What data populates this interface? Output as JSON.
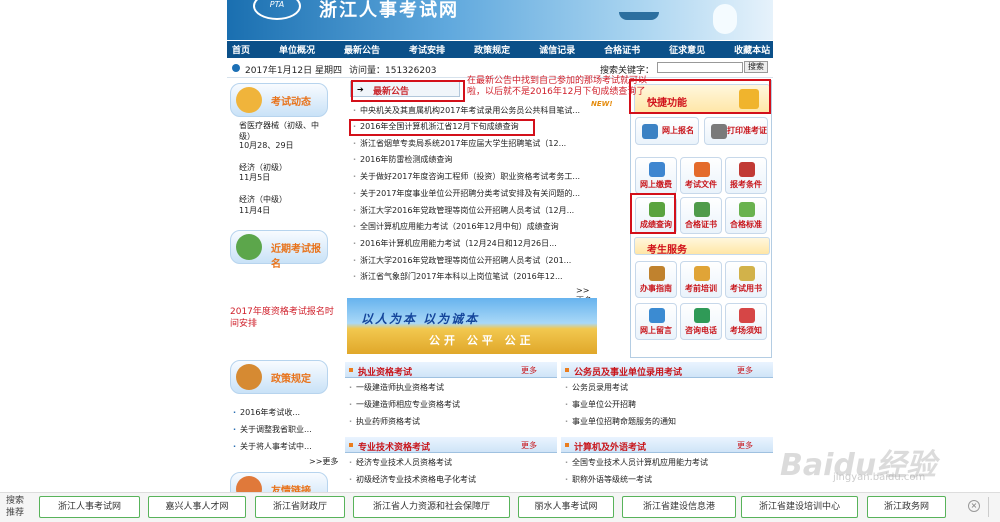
{
  "header": {
    "logo": "PTA",
    "site_title": "浙江人事考试网"
  },
  "nav": [
    "首页",
    "单位概况",
    "最新公告",
    "考试安排",
    "政策规定",
    "诚信记录",
    "合格证书",
    "征求意见",
    "收藏本站"
  ],
  "infobar": {
    "date": "2017年1月12日 星期四",
    "visits": "访问量：151326203",
    "search_label": "搜索关键字：",
    "search_value": "",
    "search_button": "搜索"
  },
  "left": {
    "exam_title": "考试动态",
    "exams": [
      {
        "name": "省医疗器械（初级、中级）",
        "date": "10月28、29日"
      },
      {
        "name": "经济（初级）",
        "date": "11月5日"
      },
      {
        "name": "经济（中级）",
        "date": "11月4日"
      }
    ],
    "reg_title": "近期考试报名",
    "reg_note": "2017年度资格考试报名时间安排",
    "policy_title": "政策规定",
    "policies": [
      "2016年考试收...",
      "关于调整我省职业...",
      "关于将人事考试中..."
    ],
    "policy_more": ">>更多",
    "friend_title": "友情链接"
  },
  "news": {
    "tab": "最新公告",
    "new_badge": "NEW!",
    "items": [
      "中央机关及其直属机构2017年考试录用公务员公共科目笔试...",
      "2016年全国计算机浙江省12月下旬成绩查询",
      "浙江省烟草专卖局系统2017年应届大学生招聘笔试（12...",
      "2016年防雷检测成绩查询",
      "关于做好2017年度咨询工程师（投资）职业资格考试考务工...",
      "关于2017年度事业单位公开招聘分类考试安排及有关问题的...",
      "浙江大学2016年党政管理等岗位公开招聘人员考试（12月...",
      "全国计算机应用能力考试（2016年12月中旬）成绩查询",
      "2016年计算机应用能力考试（12月24日和12月26日...",
      "浙江大学2016年党政管理等岗位公开招聘人员考试（201...",
      "浙江省气象部门2017年本科以上岗位笔试（2016年12..."
    ],
    "more": ">>更多",
    "banner_line1": "以人为本  以为诚本",
    "banner_line2": "公开 公平 公正"
  },
  "quick": {
    "title": "快捷功能",
    "buttons": [
      "网上报名",
      "打印准考证",
      "网上缴费",
      "考试文件",
      "报考条件",
      "成绩查询",
      "合格证书",
      "合格标准"
    ],
    "service_title": "考生服务",
    "services": [
      "办事指南",
      "考前培训",
      "考试用书",
      "网上留言",
      "咨询电话",
      "考场须知"
    ],
    "colors": {
      "accent": "#d3101a",
      "nav": "#0b5089"
    }
  },
  "categories": [
    {
      "title": "执业资格考试",
      "more": "更多",
      "items": [
        "一级建造师执业资格考试",
        "一级建造师相应专业资格考试",
        "执业药师资格考试"
      ]
    },
    {
      "title": "公务员及事业单位录用考试",
      "more": "更多",
      "items": [
        "公务员录用考试",
        "事业单位公开招聘",
        "事业单位招聘命题服务的通知"
      ]
    },
    {
      "title": "专业技术资格考试",
      "more": "更多",
      "items": [
        "经济专业技术人员资格考试",
        "初级经济专业技术资格电子化考试"
      ]
    },
    {
      "title": "计算机及外语考试",
      "more": "更多",
      "items": [
        "全国专业技术人员计算机应用能力考试",
        "职称外语等级统一考试"
      ]
    }
  ],
  "annotation": "在最新公告中找到自己参加的那场考试就可以啦，以后就不是2016年12月下旬成绩查询了",
  "bottombar": {
    "label": "搜索推荐",
    "tags": [
      "浙江人事考试网",
      "嘉兴人事人才网",
      "浙江省财政厅",
      "浙江省人力资源和社会保障厅",
      "丽水人事考试网",
      "浙江省建设信息港",
      "浙江省建设培训中心",
      "浙江政务网"
    ],
    "close": "×"
  },
  "watermark": {
    "brand": "Baidu经验",
    "url": "jingyan.baidu.com"
  }
}
